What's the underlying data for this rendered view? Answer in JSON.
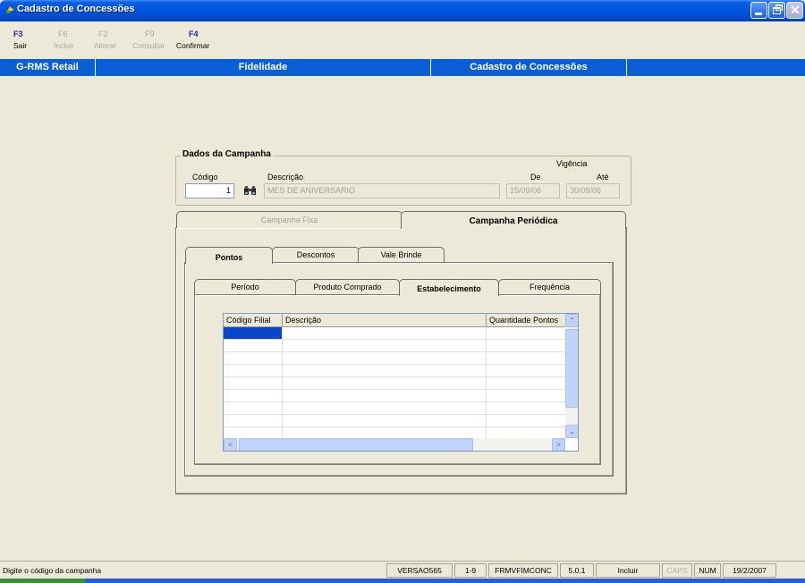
{
  "window": {
    "title": "Cadastro de Concessões",
    "close_glyph": "✕"
  },
  "toolbar": {
    "keys": [
      {
        "key": "F3",
        "label": "Sair",
        "enabled": true
      },
      {
        "key": "F6",
        "label": "Incluir",
        "enabled": false
      },
      {
        "key": "F2",
        "label": "Alterar",
        "enabled": false
      },
      {
        "key": "F9",
        "label": "Consultar",
        "enabled": false
      },
      {
        "key": "F4",
        "label": "Confirmar",
        "enabled": true
      }
    ]
  },
  "header": {
    "app": "G-RMS Retail",
    "module": "Fidelidade",
    "screen": "Cadastro de Concessões"
  },
  "campanha": {
    "group_title": "Dados da Campanha",
    "codigo_label": "Código",
    "codigo_value": "1",
    "descricao_label": "Descrição",
    "descricao_value": "MES DE ANIVERSARIO",
    "vigencia_label": "Vigência",
    "de_label": "De",
    "de_value": "15/09/06",
    "ate_label": "Até",
    "ate_value": "30/09/06"
  },
  "outer_tabs": {
    "fixa": "Campanha Fixa",
    "periodica": "Campanha Periódica"
  },
  "middle_tabs": {
    "pontos": "Pontos",
    "descontos": "Descontos",
    "vale_brinde": "Vale Brinde"
  },
  "inner_tabs": {
    "periodo": "Período",
    "produto": "Produto Comprado",
    "estabelecimento": "Estabelecimento",
    "frequencia": "Frequência"
  },
  "grid": {
    "columns": [
      "Código Filial",
      "Descrição",
      "Quantidade Pontos"
    ],
    "scroll_up": "⌃",
    "scroll_down": "⌄",
    "scroll_left": "<",
    "scroll_right": ">"
  },
  "statusbar": {
    "message": "Digite o código da campanha",
    "version": "VERSAO565",
    "record": "1-9",
    "form": "FRMVFIMCONC",
    "build": "5.0.1",
    "mode": "Incluir",
    "caps": "CAPS",
    "num": "NUM",
    "date": "19/2/2007"
  },
  "colors": {
    "accent": "#0A5ED6",
    "window_bg": "#ECE9D8",
    "titlebar": "#0054E3"
  }
}
